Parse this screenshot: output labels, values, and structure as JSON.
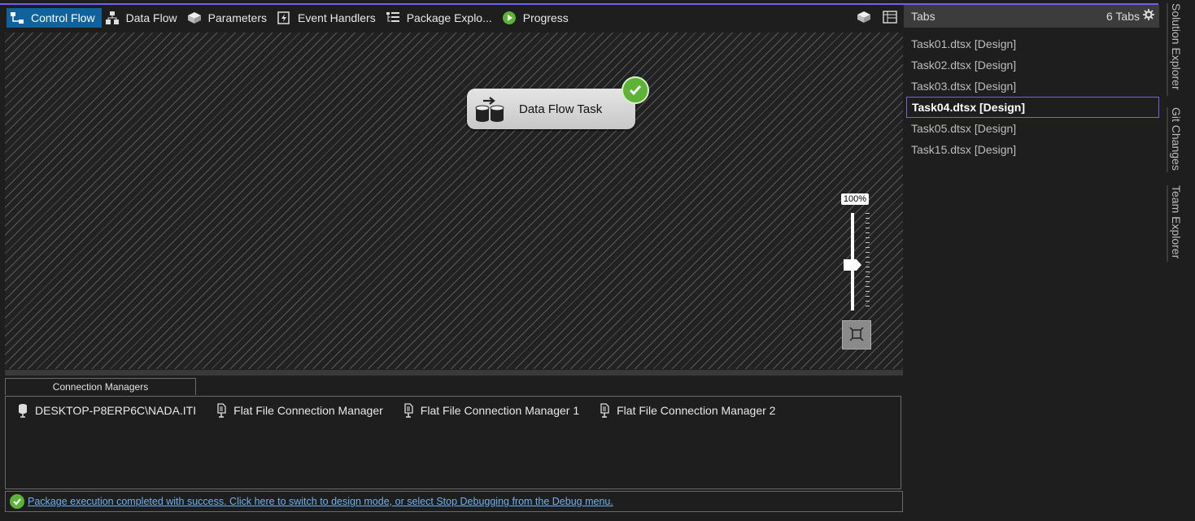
{
  "designer_tabs": [
    {
      "label": "Control Flow",
      "icon": "control-flow-icon",
      "active": true
    },
    {
      "label": "Data Flow",
      "icon": "data-flow-icon",
      "active": false
    },
    {
      "label": "Parameters",
      "icon": "parameters-icon",
      "active": false
    },
    {
      "label": "Event Handlers",
      "icon": "event-handlers-icon",
      "active": false
    },
    {
      "label": "Package Explo...",
      "icon": "package-explorer-icon",
      "active": false
    },
    {
      "label": "Progress",
      "icon": "progress-play-icon",
      "active": false
    }
  ],
  "canvas": {
    "task_label": "Data Flow Task",
    "task_status": "success",
    "zoom_label": "100%"
  },
  "connection_managers": {
    "tab_label": "Connection Managers",
    "items": [
      {
        "label": "DESKTOP-P8ERP6C\\NADA.ITI",
        "icon": "ole-db-connection-icon"
      },
      {
        "label": "Flat File Connection Manager",
        "icon": "flat-file-connection-icon"
      },
      {
        "label": "Flat File Connection Manager 1",
        "icon": "flat-file-connection-icon"
      },
      {
        "label": "Flat File Connection Manager 2",
        "icon": "flat-file-connection-icon"
      }
    ]
  },
  "status_bar": {
    "message": "Package execution completed with success. Click here to switch to design mode, or select Stop Debugging from the Debug menu."
  },
  "tabs_panel": {
    "title": "Tabs",
    "count": "6 Tabs",
    "items": [
      "Task01.dtsx [Design]",
      "Task02.dtsx [Design]",
      "Task03.dtsx [Design]",
      "Task04.dtsx [Design]",
      "Task05.dtsx [Design]",
      "Task15.dtsx [Design]"
    ],
    "selected_index": 3
  },
  "side_tabs": [
    "Solution Explorer",
    "Git Changes",
    "Team Explorer"
  ],
  "colors": {
    "accent": "#7160e8",
    "active_tab": "#0e639c",
    "success": "#5cb338",
    "link": "#6fb0f0"
  }
}
